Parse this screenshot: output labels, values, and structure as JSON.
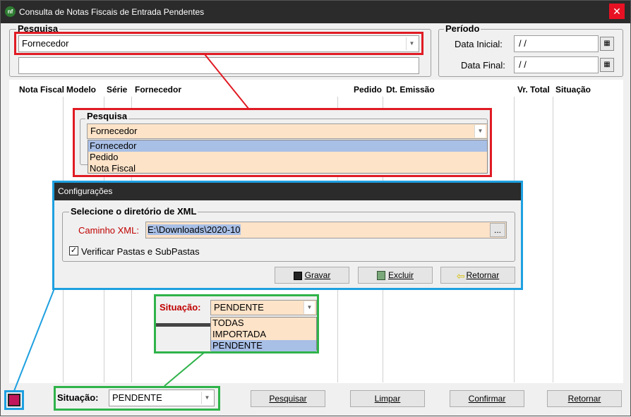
{
  "window": {
    "title": "Consulta de Notas Fiscais de Entrada Pendentes",
    "close_label": "✕"
  },
  "pesquisa": {
    "legend": "Pesquisa",
    "selected": "Fornecedor",
    "text_value": ""
  },
  "periodo": {
    "legend": "Período",
    "inicial_label": "Data Inicial:",
    "inicial_value": " /  /",
    "final_label": "Data Final:",
    "final_value": " /  /"
  },
  "grid": {
    "columns": [
      "Nota Fiscal",
      "Modelo",
      "Série",
      "Fornecedor",
      "Pedido",
      "Dt. Emissão",
      "Vr. Total",
      "Situação"
    ]
  },
  "pesquisa_callout": {
    "legend": "Pesquisa",
    "selected": "Fornecedor",
    "options": [
      "Fornecedor",
      "Pedido",
      "Nota Fiscal"
    ]
  },
  "config": {
    "title": "Configurações",
    "group_legend": "Selecione o diretório de XML",
    "path_label": "Caminho XML:",
    "path_value": "E:\\Downloads\\2020-10",
    "browse_label": "...",
    "checkbox_label": "Verificar Pastas e SubPastas",
    "checkbox_checked": true,
    "gravar": "Gravar",
    "excluir": "Excluir",
    "retornar": "Retornar"
  },
  "situacao_callout": {
    "label": "Situação:",
    "selected": "PENDENTE",
    "options": [
      "TODAS",
      "IMPORTADA",
      "PENDENTE"
    ]
  },
  "footer": {
    "situacao_label": "Situação:",
    "situacao_value": "PENDENTE",
    "pesquisar": "Pesquisar",
    "limpar": "Limpar",
    "confirmar": "Confirmar",
    "retornar": "Retornar"
  },
  "colors": {
    "red_highlight": "#e01b24",
    "green_highlight": "#2fb34a",
    "blue_highlight": "#1ea0e0",
    "field_fill": "#fde3c8",
    "selection": "#a8bfe6"
  }
}
